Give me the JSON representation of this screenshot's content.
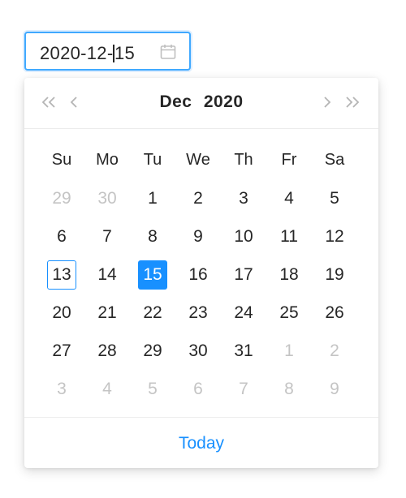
{
  "input": {
    "value_before_caret": "2020-12-",
    "value_after_caret": "15",
    "icon": "calendar-icon"
  },
  "header": {
    "month": "Dec",
    "year": "2020",
    "prev_year_icon": "double-chevron-left-icon",
    "prev_month_icon": "chevron-left-icon",
    "next_month_icon": "chevron-right-icon",
    "next_year_icon": "double-chevron-right-icon"
  },
  "weekdays": [
    "Su",
    "Mo",
    "Tu",
    "We",
    "Th",
    "Fr",
    "Sa"
  ],
  "weeks": [
    [
      {
        "d": "29",
        "muted": true
      },
      {
        "d": "30",
        "muted": true
      },
      {
        "d": "1"
      },
      {
        "d": "2"
      },
      {
        "d": "3"
      },
      {
        "d": "4"
      },
      {
        "d": "5"
      }
    ],
    [
      {
        "d": "6"
      },
      {
        "d": "7"
      },
      {
        "d": "8"
      },
      {
        "d": "9"
      },
      {
        "d": "10"
      },
      {
        "d": "11"
      },
      {
        "d": "12"
      }
    ],
    [
      {
        "d": "13",
        "today": true
      },
      {
        "d": "14"
      },
      {
        "d": "15",
        "selected": true
      },
      {
        "d": "16"
      },
      {
        "d": "17"
      },
      {
        "d": "18"
      },
      {
        "d": "19"
      }
    ],
    [
      {
        "d": "20"
      },
      {
        "d": "21"
      },
      {
        "d": "22"
      },
      {
        "d": "23"
      },
      {
        "d": "24"
      },
      {
        "d": "25"
      },
      {
        "d": "26"
      }
    ],
    [
      {
        "d": "27"
      },
      {
        "d": "28"
      },
      {
        "d": "29"
      },
      {
        "d": "30"
      },
      {
        "d": "31"
      },
      {
        "d": "1",
        "muted": true
      },
      {
        "d": "2",
        "muted": true
      }
    ],
    [
      {
        "d": "3",
        "muted": true
      },
      {
        "d": "4",
        "muted": true
      },
      {
        "d": "5",
        "muted": true
      },
      {
        "d": "6",
        "muted": true
      },
      {
        "d": "7",
        "muted": true
      },
      {
        "d": "8",
        "muted": true
      },
      {
        "d": "9",
        "muted": true
      }
    ]
  ],
  "footer": {
    "today_label": "Today"
  },
  "colors": {
    "accent": "#1890ff",
    "muted_text": "#c4c4c4",
    "text": "#262626"
  }
}
